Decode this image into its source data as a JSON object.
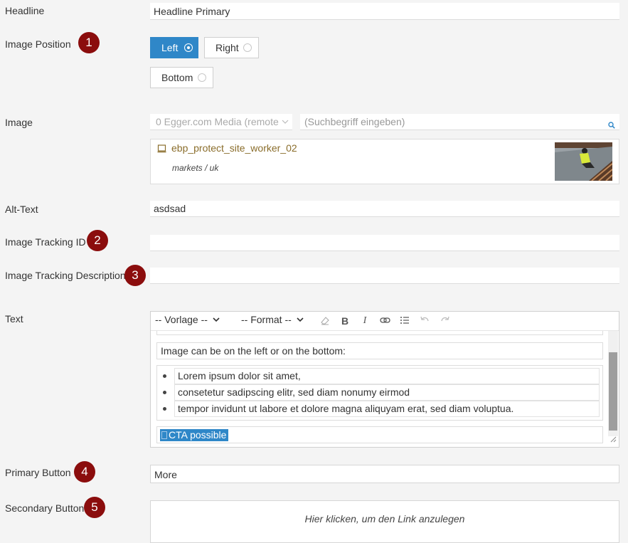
{
  "form": {
    "headline": {
      "label": "Headline",
      "value": "Headline Primary"
    },
    "image_position": {
      "label": "Image Position",
      "badge": "1",
      "options": [
        {
          "label": "Left",
          "selected": true
        },
        {
          "label": "Right",
          "selected": false
        },
        {
          "label": "Bottom",
          "selected": false
        }
      ]
    },
    "image": {
      "label": "Image",
      "source_select": "0 Egger.com Media (remote",
      "search_placeholder": "(Suchbegriff eingeben)",
      "item_name": "ebp_protect_site_worker_02",
      "item_path": "markets / uk"
    },
    "alt_text": {
      "label": "Alt-Text",
      "value": "asdsad"
    },
    "image_tracking_id": {
      "label": "Image Tracking ID",
      "badge": "2",
      "value": ""
    },
    "image_tracking_description": {
      "label": "Image Tracking Description",
      "badge": "3",
      "value": ""
    },
    "text": {
      "label": "Text",
      "toolbar": {
        "template_select": "-- Vorlage --",
        "format_select": "-- Format --"
      },
      "paragraph": "Image can be on the left or on the bottom:",
      "list": [
        "Lorem ipsum dolor sit amet,",
        "consetetur sadipscing elitr, sed diam nonumy eirmod",
        "tempor invidunt ut labore et dolore magna aliquyam erat, sed diam voluptua."
      ],
      "cta": "CTA possible"
    },
    "primary_button": {
      "label": "Primary Button",
      "badge": "4",
      "value": "More"
    },
    "secondary_button": {
      "label": "Secondary Button",
      "badge": "5",
      "placeholder": "Hier klicken, um den Link anzulegen"
    }
  },
  "colors": {
    "accent": "#2f87c8",
    "badge": "#8b0d0d",
    "link": "#8a6d2b"
  },
  "icons": [
    "radio-icon",
    "chevron-down-icon",
    "search-icon",
    "media-item-icon",
    "eraser-icon",
    "bold-icon",
    "italic-icon",
    "link-icon",
    "list-icon",
    "undo-icon",
    "redo-icon",
    "link-marker-icon",
    "resize-handle-icon"
  ]
}
